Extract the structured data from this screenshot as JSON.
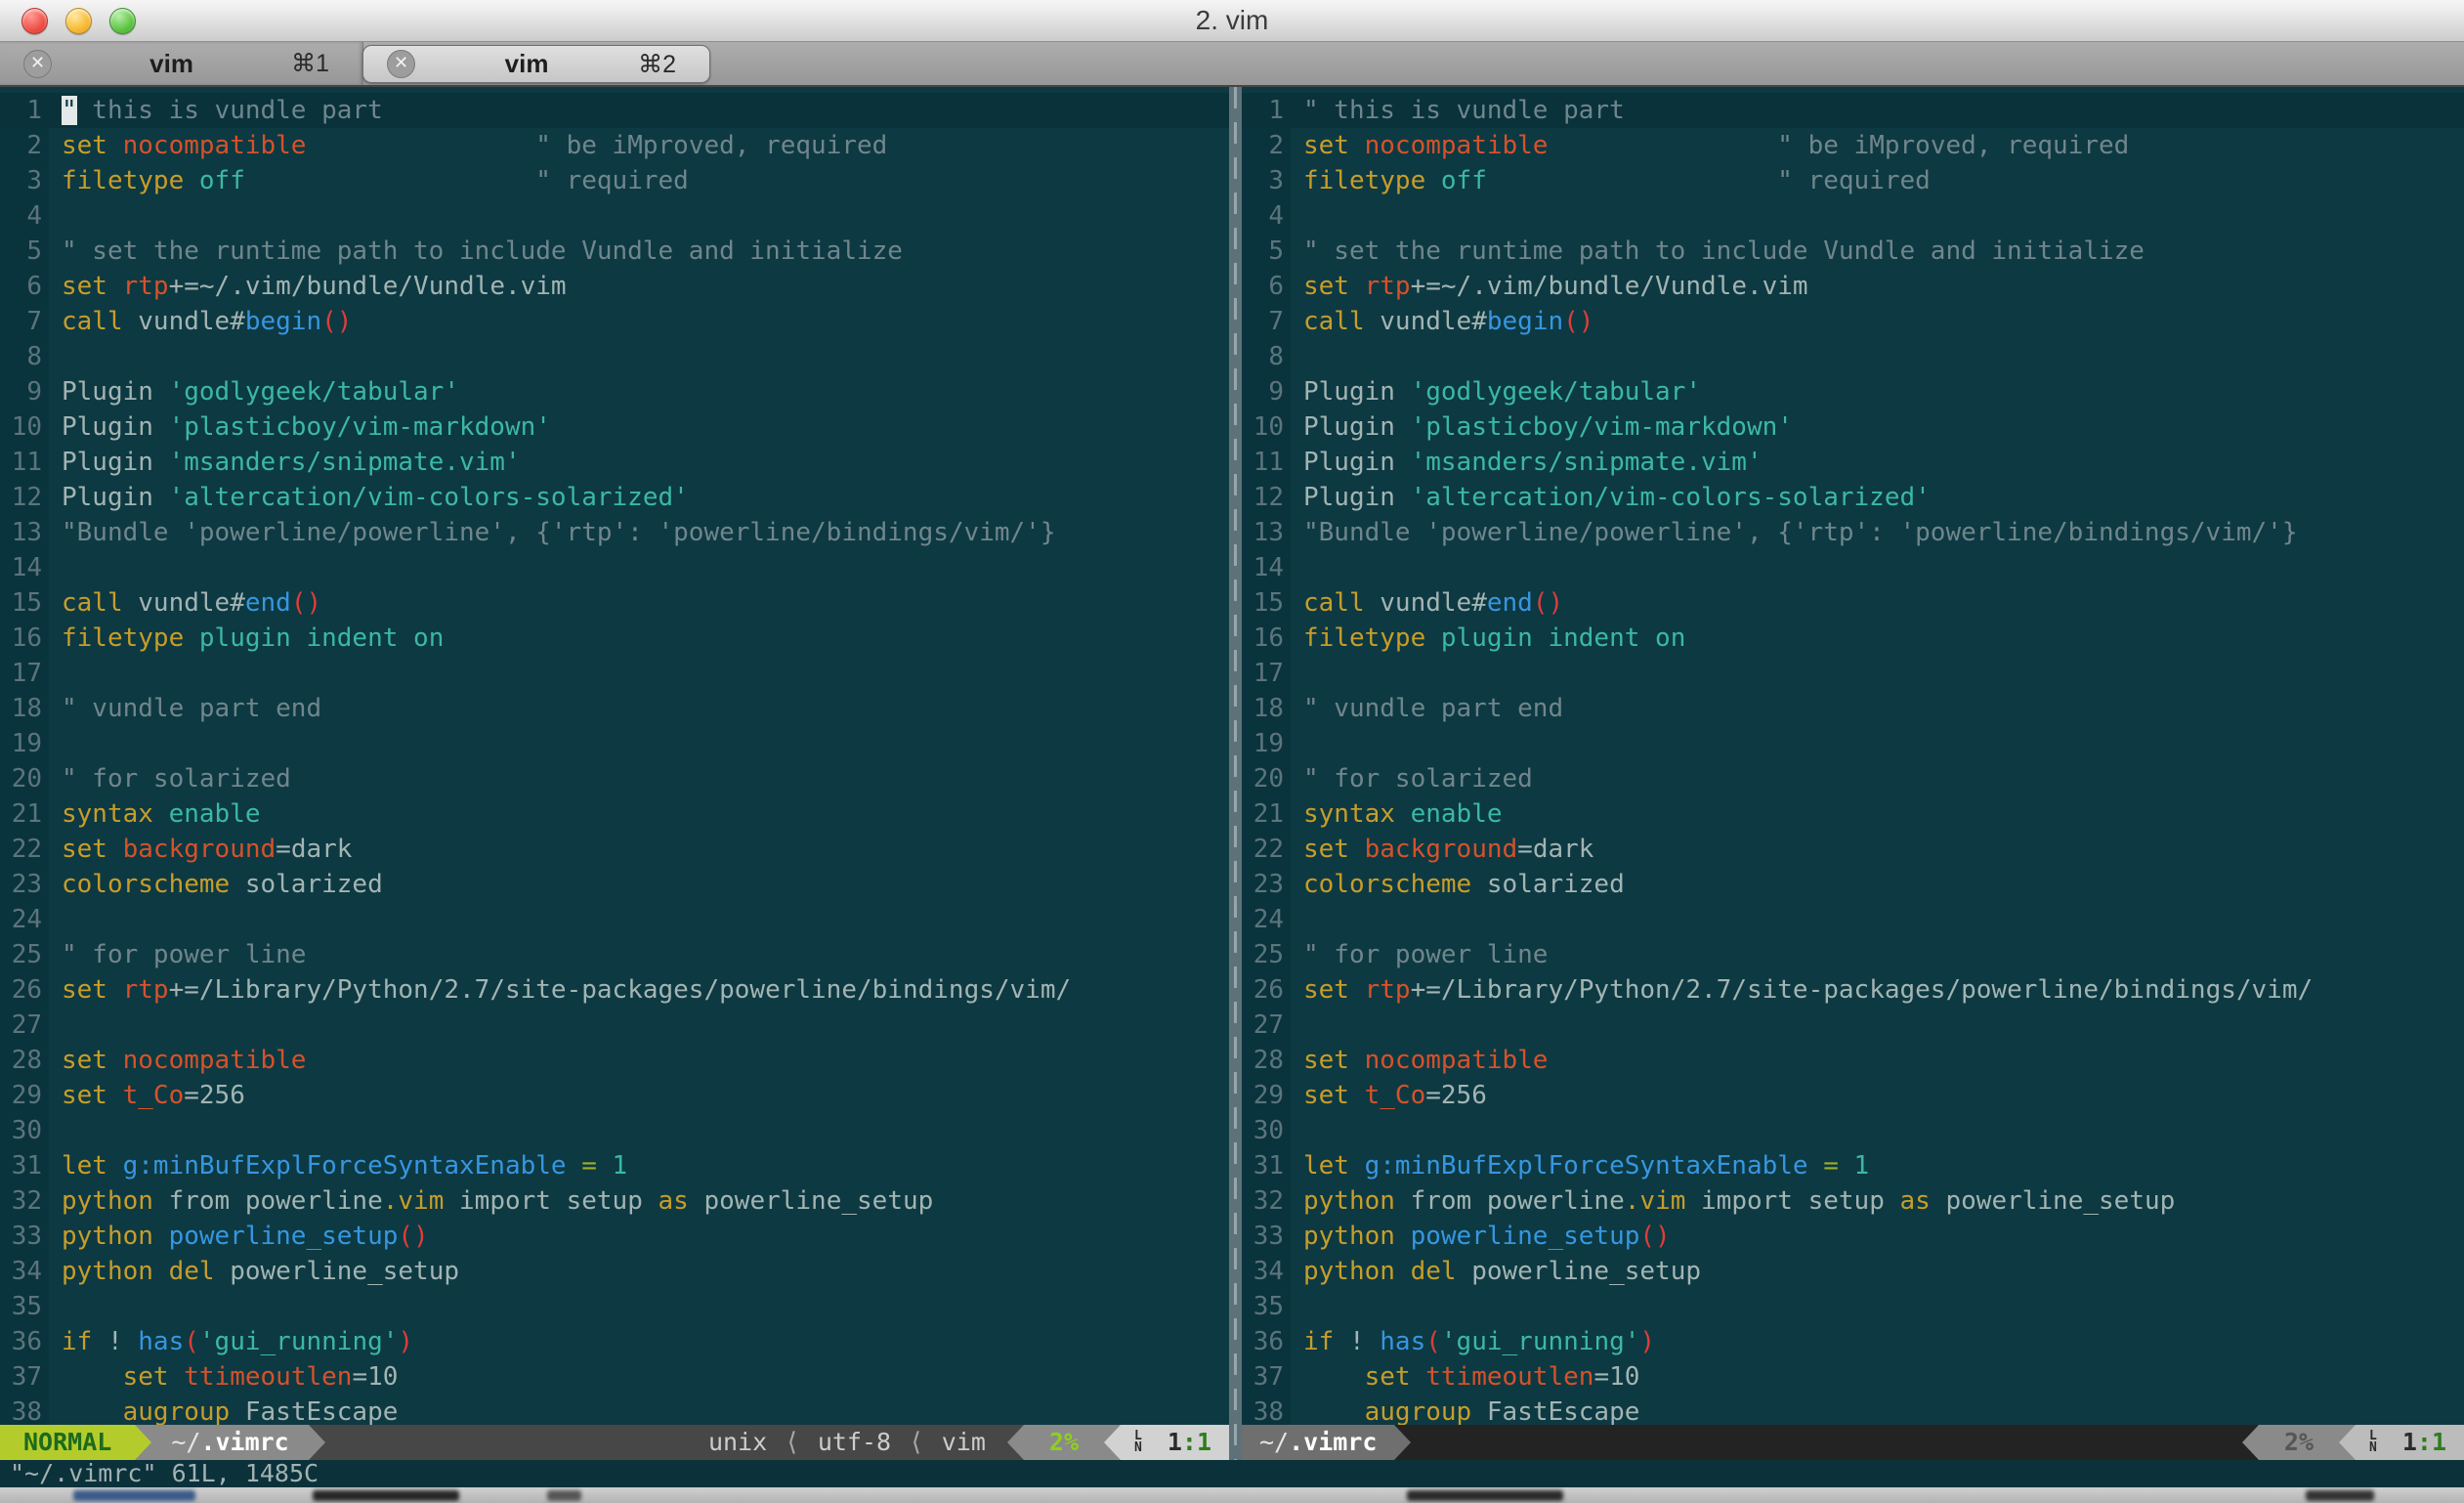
{
  "window": {
    "title": "2. vim"
  },
  "tabs": [
    {
      "label": "vim",
      "shortcut": "⌘1",
      "close_glyph": "✕",
      "active": false
    },
    {
      "label": "vim",
      "shortcut": "⌘2",
      "close_glyph": "✕",
      "active": true
    }
  ],
  "colors": {
    "terminal_bg": "#0d3942",
    "cursorline_bg": "#09323b",
    "gutter_bg": "#0a343d",
    "comment": "#70868c",
    "normal_text": "#a3b4b3",
    "keyword_yellow": "#c79d2a",
    "identifier_orange": "#d5522b",
    "string_cyan": "#3bb8a6",
    "function_blue": "#3796e0",
    "paren_red": "#df3d3a",
    "operator_green": "#9fae24",
    "line_number": "#5c747c",
    "mode_bg": "#b4cc2b",
    "mode_text": "#1d6a1d",
    "percent_green": "#8dd01e",
    "position_green": "#2e7d1a"
  },
  "cursor": {
    "line": 1,
    "col": 1,
    "pane": "left"
  },
  "buffer": {
    "lines": [
      {
        "n": 1,
        "cursorline": true,
        "segs": [
          [
            "comment",
            "\" this is vundle part"
          ]
        ]
      },
      {
        "n": 2,
        "segs": [
          [
            "kw",
            "set"
          ],
          [
            "n",
            " "
          ],
          [
            "orange",
            "nocompatible"
          ],
          [
            "n",
            "               "
          ],
          [
            "comment",
            "\" be iMproved, required"
          ]
        ]
      },
      {
        "n": 3,
        "segs": [
          [
            "kw",
            "filetype"
          ],
          [
            "n",
            " "
          ],
          [
            "cyan",
            "off"
          ],
          [
            "n",
            "                   "
          ],
          [
            "comment",
            "\" required"
          ]
        ]
      },
      {
        "n": 4,
        "segs": []
      },
      {
        "n": 5,
        "segs": [
          [
            "comment",
            "\" set the runtime path to include Vundle and initialize"
          ]
        ]
      },
      {
        "n": 6,
        "segs": [
          [
            "kw",
            "set"
          ],
          [
            "n",
            " "
          ],
          [
            "orange",
            "rtp"
          ],
          [
            "n",
            "+=~/.vim/bundle/Vundle.vim"
          ]
        ]
      },
      {
        "n": 7,
        "segs": [
          [
            "kw",
            "call"
          ],
          [
            "n",
            " vundle#"
          ],
          [
            "blue",
            "begin"
          ],
          [
            "red",
            "()"
          ]
        ]
      },
      {
        "n": 8,
        "segs": []
      },
      {
        "n": 9,
        "segs": [
          [
            "n",
            "Plugin "
          ],
          [
            "cyan",
            "'godlygeek/tabular'"
          ]
        ]
      },
      {
        "n": 10,
        "segs": [
          [
            "n",
            "Plugin "
          ],
          [
            "cyan",
            "'plasticboy/vim-markdown'"
          ]
        ]
      },
      {
        "n": 11,
        "segs": [
          [
            "n",
            "Plugin "
          ],
          [
            "cyan",
            "'msanders/snipmate.vim'"
          ]
        ]
      },
      {
        "n": 12,
        "segs": [
          [
            "n",
            "Plugin "
          ],
          [
            "cyan",
            "'altercation/vim-colors-solarized'"
          ]
        ]
      },
      {
        "n": 13,
        "segs": [
          [
            "comment",
            "\"Bundle 'powerline/powerline', {'rtp': 'powerline/bindings/vim/'}"
          ]
        ]
      },
      {
        "n": 14,
        "segs": []
      },
      {
        "n": 15,
        "segs": [
          [
            "kw",
            "call"
          ],
          [
            "n",
            " vundle#"
          ],
          [
            "blue",
            "end"
          ],
          [
            "red",
            "()"
          ]
        ]
      },
      {
        "n": 16,
        "segs": [
          [
            "kw",
            "filetype"
          ],
          [
            "n",
            " "
          ],
          [
            "cyan",
            "plugin"
          ],
          [
            "n",
            " "
          ],
          [
            "cyan",
            "indent"
          ],
          [
            "n",
            " "
          ],
          [
            "cyan",
            "on"
          ]
        ]
      },
      {
        "n": 17,
        "segs": []
      },
      {
        "n": 18,
        "segs": [
          [
            "comment",
            "\" vundle part end"
          ]
        ]
      },
      {
        "n": 19,
        "segs": []
      },
      {
        "n": 20,
        "segs": [
          [
            "comment",
            "\" for solarized"
          ]
        ]
      },
      {
        "n": 21,
        "segs": [
          [
            "kw",
            "syntax"
          ],
          [
            "n",
            " "
          ],
          [
            "cyan",
            "enable"
          ]
        ]
      },
      {
        "n": 22,
        "segs": [
          [
            "kw",
            "set"
          ],
          [
            "n",
            " "
          ],
          [
            "orange",
            "background"
          ],
          [
            "n",
            "=dark"
          ]
        ]
      },
      {
        "n": 23,
        "segs": [
          [
            "kw",
            "colorscheme"
          ],
          [
            "n",
            " solarized"
          ]
        ]
      },
      {
        "n": 24,
        "segs": []
      },
      {
        "n": 25,
        "segs": [
          [
            "comment",
            "\" for power line"
          ]
        ]
      },
      {
        "n": 26,
        "segs": [
          [
            "kw",
            "set"
          ],
          [
            "n",
            " "
          ],
          [
            "orange",
            "rtp"
          ],
          [
            "n",
            "+=/Library/Python/2.7/site-packages/powerline/bindings/vim/"
          ]
        ]
      },
      {
        "n": 27,
        "segs": []
      },
      {
        "n": 28,
        "segs": [
          [
            "kw",
            "set"
          ],
          [
            "n",
            " "
          ],
          [
            "orange",
            "nocompatible"
          ]
        ]
      },
      {
        "n": 29,
        "segs": [
          [
            "kw",
            "set"
          ],
          [
            "n",
            " "
          ],
          [
            "orange",
            "t_Co"
          ],
          [
            "n",
            "=256"
          ]
        ]
      },
      {
        "n": 30,
        "segs": []
      },
      {
        "n": 31,
        "segs": [
          [
            "kw",
            "let"
          ],
          [
            "n",
            " "
          ],
          [
            "blue",
            "g:minBufExplForceSyntaxEnable"
          ],
          [
            "green",
            " = "
          ],
          [
            "cyan",
            "1"
          ]
        ]
      },
      {
        "n": 32,
        "segs": [
          [
            "kw",
            "python"
          ],
          [
            "n",
            " from powerline"
          ],
          [
            "kw",
            ".vim"
          ],
          [
            "n",
            " import setup "
          ],
          [
            "kw",
            "as"
          ],
          [
            "n",
            " powerline_setup"
          ]
        ]
      },
      {
        "n": 33,
        "segs": [
          [
            "kw",
            "python"
          ],
          [
            "n",
            " "
          ],
          [
            "blue",
            "powerline_setup"
          ],
          [
            "red",
            "()"
          ]
        ]
      },
      {
        "n": 34,
        "segs": [
          [
            "kw",
            "python"
          ],
          [
            "n",
            " "
          ],
          [
            "kw",
            "del"
          ],
          [
            "n",
            " powerline_setup"
          ]
        ]
      },
      {
        "n": 35,
        "segs": []
      },
      {
        "n": 36,
        "segs": [
          [
            "kw",
            "if"
          ],
          [
            "n",
            " ! "
          ],
          [
            "blue",
            "has"
          ],
          [
            "red",
            "("
          ],
          [
            "cyan",
            "'gui_running'"
          ],
          [
            "red",
            ")"
          ]
        ]
      },
      {
        "n": 37,
        "segs": [
          [
            "n",
            "    "
          ],
          [
            "kw",
            "set"
          ],
          [
            "n",
            " "
          ],
          [
            "orange",
            "ttimeoutlen"
          ],
          [
            "n",
            "=10"
          ]
        ]
      },
      {
        "n": 38,
        "segs": [
          [
            "n",
            "    "
          ],
          [
            "kw",
            "augroup"
          ],
          [
            "n",
            " FastEscape"
          ]
        ]
      }
    ]
  },
  "statusline_left": {
    "mode": "NORMAL",
    "file_prefix": "~/",
    "file_name": ".vimrc",
    "format": "unix",
    "separator": "⟨",
    "encoding": "utf-8",
    "filetype": "vim",
    "percent": "2%",
    "ln_top": "L",
    "ln_bottom": "N",
    "pos_line": "1",
    "pos_col": ":1"
  },
  "statusline_right": {
    "file_prefix": "~/",
    "file_name": ".vimrc",
    "percent": "2%",
    "ln_top": "L",
    "ln_bottom": "N",
    "pos_line": "1",
    "pos_col": ":1"
  },
  "cmdline": "\"~/.vimrc\" 61L, 1485C"
}
